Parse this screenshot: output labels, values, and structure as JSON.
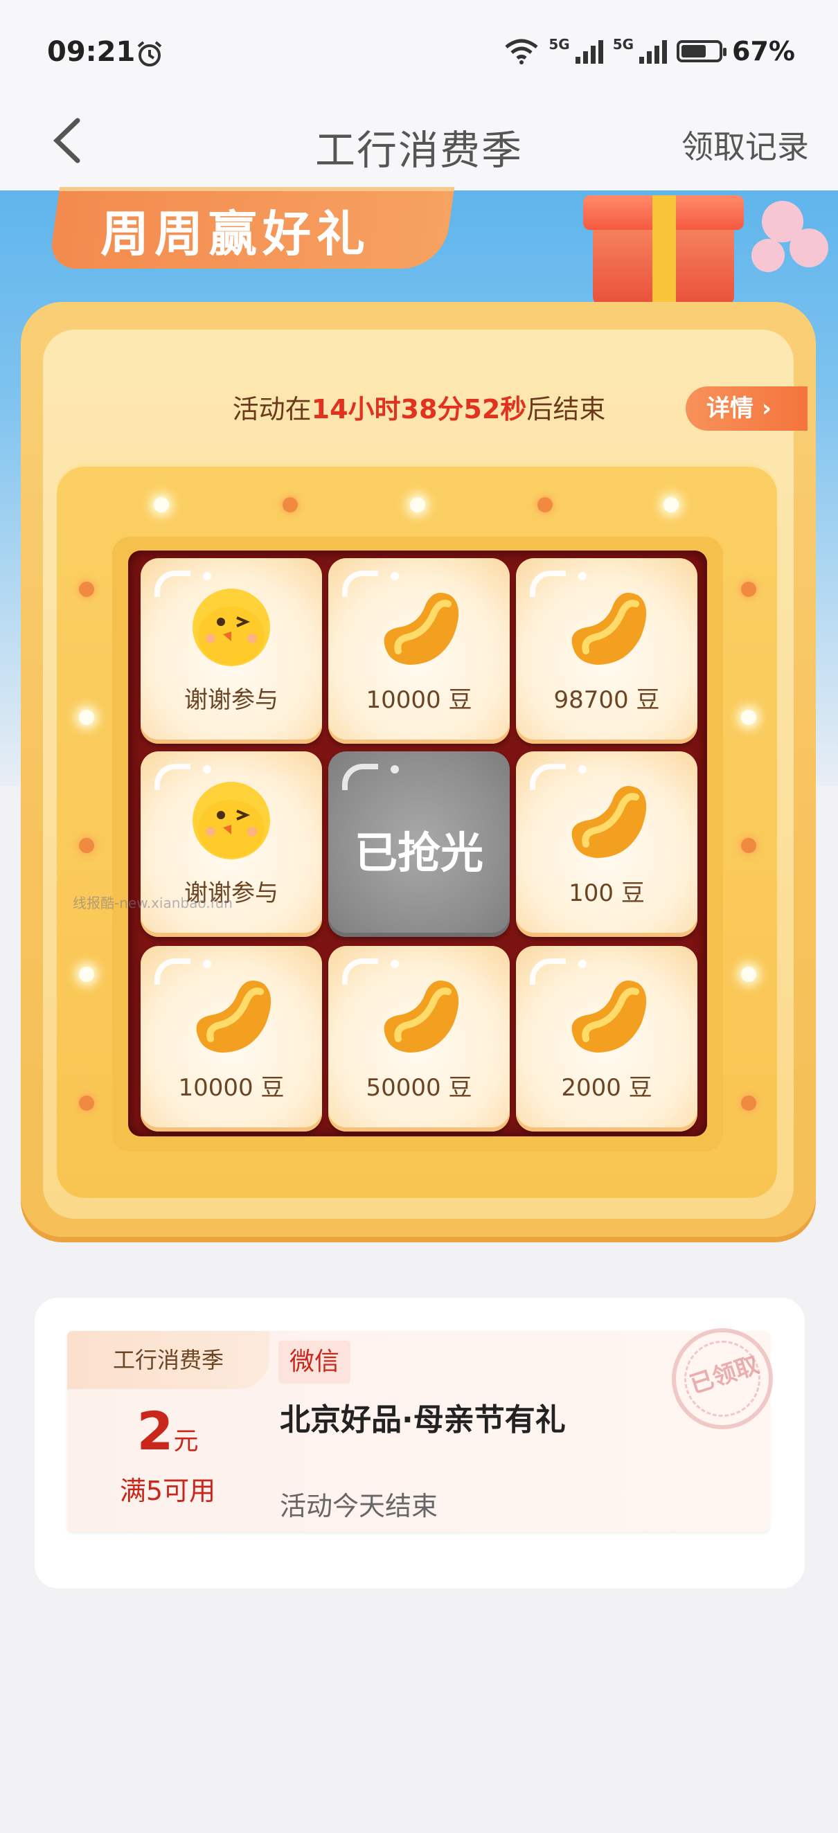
{
  "status_bar": {
    "time": "09:21",
    "net_tag_1": "5G",
    "net_tag_2": "5G",
    "battery_pct": "67%",
    "battery_level": 0.67
  },
  "nav": {
    "title": "工行消费季",
    "action": "领取记录"
  },
  "banner": {
    "title": "周周赢好礼"
  },
  "countdown": {
    "prefix": "活动在",
    "time": "14小时38分52秒",
    "suffix": "后结束"
  },
  "details_button": "详情 ›",
  "grid": {
    "cells": [
      {
        "type": "thanks",
        "label": "谢谢参与"
      },
      {
        "type": "bean",
        "label": "10000 豆"
      },
      {
        "type": "bean",
        "label": "98700 豆"
      },
      {
        "type": "thanks",
        "label": "谢谢参与"
      },
      {
        "type": "soldout",
        "label": "已抢光"
      },
      {
        "type": "bean",
        "label": "100 豆"
      },
      {
        "type": "bean",
        "label": "10000 豆"
      },
      {
        "type": "bean",
        "label": "50000 豆"
      },
      {
        "type": "bean",
        "label": "2000 豆"
      }
    ]
  },
  "watermark": "线报酷-new.xianbao.fun",
  "coupon": {
    "tag": "工行消费季",
    "amount": "2",
    "unit": "元",
    "condition": "满5可用",
    "channel": "微信",
    "title": "北京好品·母亲节有礼",
    "subtitle": "活动今天结束",
    "stamp": "已领取"
  },
  "colors": {
    "accent_red": "#c9261c",
    "frame_gold": "#f7c25c",
    "board_maroon": "#7a1312"
  },
  "icons": [
    "alarm-icon",
    "wifi-icon",
    "signal-icon",
    "battery-icon",
    "back-arrow-icon",
    "chick-icon",
    "bean-icon",
    "chevron-right-icon"
  ]
}
